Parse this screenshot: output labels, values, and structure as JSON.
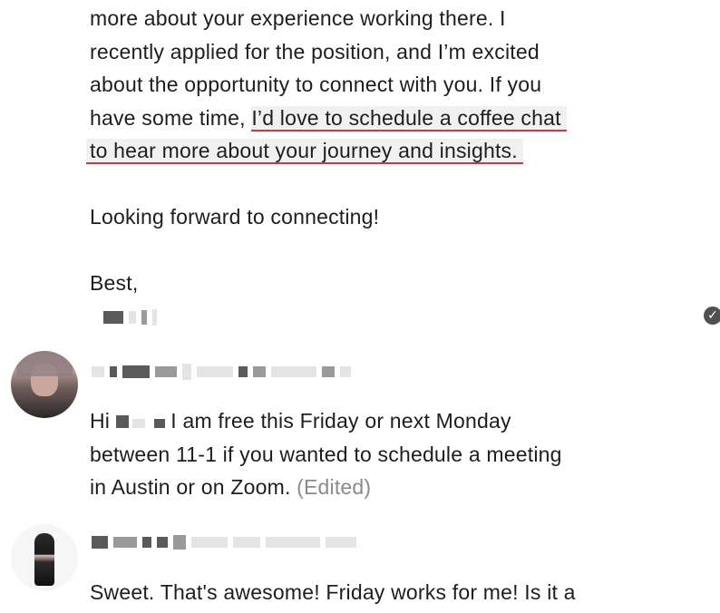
{
  "messages": [
    {
      "lines": [
        "more about your experience working there. I",
        "recently applied for the position, and I’m excited",
        "about the opportunity to connect with you. If you",
        "have some time, "
      ],
      "highlight_line_1": "I’d love to schedule a coffee chat",
      "highlight_line_2": "to hear more about your journey and insights.",
      "closing": "Looking forward to connecting!",
      "signoff": "Best,"
    },
    {
      "text_prefix": "Hi ",
      "text_suffix": " I am free this Friday or next Monday",
      "line_2": "between 11-1 if you wanted to schedule a meeting",
      "line_3": "in Austin or on Zoom. ",
      "edited_label": "(Edited)"
    },
    {
      "text": "Sweet. That's awesome! Friday works for me! Is it a"
    }
  ],
  "icons": {
    "read_receipt": "check-circle-icon"
  }
}
